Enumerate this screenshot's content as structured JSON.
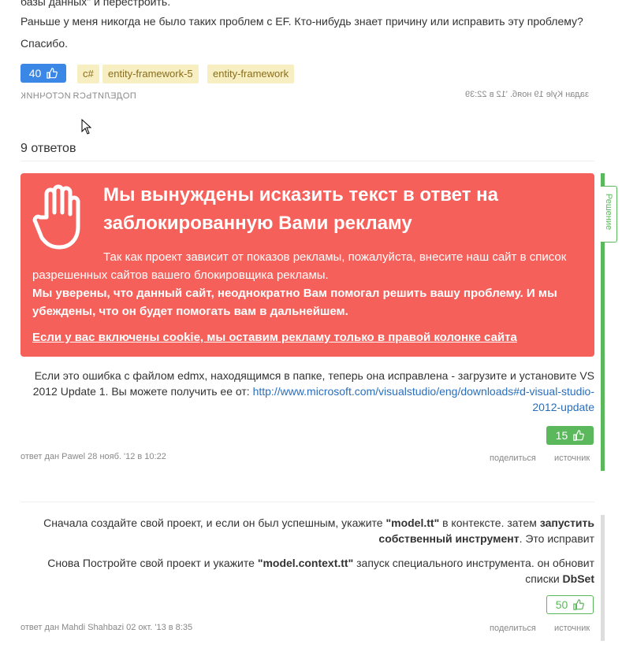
{
  "question": {
    "partial_line": "базы данных\" и перестроить.",
    "line1": "Раньше у меня никогда не было таких проблем с EF. Кто-нибудь знает причину или исправить эту проблему?",
    "line2": "Спасибо.",
    "votes": "40",
    "tags": [
      "c#",
      "entity-framework-5",
      "entity-framework"
    ],
    "action_source": "ИСТОЧНИК",
    "action_share": "ПОДЕЛИТЬСЯ",
    "asked_by": "задан Kyle 19 нояб. '12 в 22:39"
  },
  "answers_count": "9 ответов",
  "ad": {
    "heading": "Мы вынуждены исказить текст в ответ на заблокированную Вами рекламу",
    "text1": "Так как проект зависит от показов рекламы, пожалуйста, внесите наш сайт в список разрешенных сайтов вашего блокировщика рекламы.",
    "text2": "Мы уверены, что данный сайт, неоднократно Вам помогал решить вашу проблему. И мы убеждены, что он будет помогать вам в дальнейшем.",
    "link": "Если у вас включены cookie, мы оставим рекламу только в правой колонке сайта"
  },
  "accepted_label": "Решение",
  "answer1": {
    "text": "Если это ошибка с файлом edmx, находящимся в папке, теперь она исправлена - загрузите и установите VS 2012 Update 1. Вы можете получить ее от: ",
    "url": "http://www.microsoft.com/visualstudio/eng/downloads#d-visual-studio-2012-update",
    "votes": "15",
    "author": "ответ дан Pawel 28 нояб. '12 в 10:22",
    "share": "поделиться",
    "source": "источник"
  },
  "answer2": {
    "p1_a": "Сначала создайте свой проект, и если он был успешным, укажите ",
    "p1_b": "\"model.tt\"",
    "p1_c": " в контексте. затем ",
    "p1_d": "запустить",
    "p1_e": "собственный инструмент",
    "p1_f": ". Это исправит",
    "p2_a": "Снова Постройте свой проект и укажите ",
    "p2_b": "\"model.context.tt\"",
    "p2_c": " запуск специального инструмента. он обновит",
    "p2_d": "списки ",
    "p2_e": "DbSet",
    "votes": "50",
    "author": "ответ дан Mahdi Shahbazi 02 окт. '13 в 8:35",
    "share": "поделиться",
    "source": "источник"
  },
  "colors": {
    "ad_bg": "#f5605a",
    "accepted": "#5cb85c",
    "vote_blue": "#3b87e6",
    "tag_bg": "#f7efc2"
  }
}
